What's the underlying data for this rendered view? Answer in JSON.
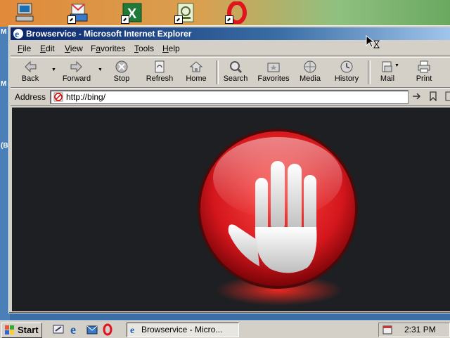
{
  "window": {
    "title": "Browservice - Microsoft Internet Explorer"
  },
  "menu": {
    "items": [
      {
        "key": "F",
        "rest": "ile"
      },
      {
        "key": "E",
        "rest": "dit"
      },
      {
        "key": "V",
        "rest": "iew"
      },
      {
        "key": "",
        "rest": "Favorites",
        "underline_idx": 1
      },
      {
        "key": "T",
        "rest": "ools"
      },
      {
        "key": "H",
        "rest": "elp"
      }
    ]
  },
  "toolbar": {
    "back": "Back",
    "forward": "Forward",
    "stop": "Stop",
    "refresh": "Refresh",
    "home": "Home",
    "search": "Search",
    "favorites": "Favorites",
    "media": "Media",
    "history": "History",
    "mail": "Mail",
    "print": "Print"
  },
  "address": {
    "label": "Address",
    "value": "http://bing/"
  },
  "desktop": {
    "left_labels": [
      "M",
      "M",
      "(B"
    ]
  },
  "taskbar": {
    "start": "Start",
    "task_title": "Browservice - Micro...",
    "clock": "2:31 PM"
  },
  "colors": {
    "title_start": "#0a246a",
    "title_end": "#a6caf0",
    "stop_red": "#d3161c",
    "content_bg": "#1e1f22"
  }
}
